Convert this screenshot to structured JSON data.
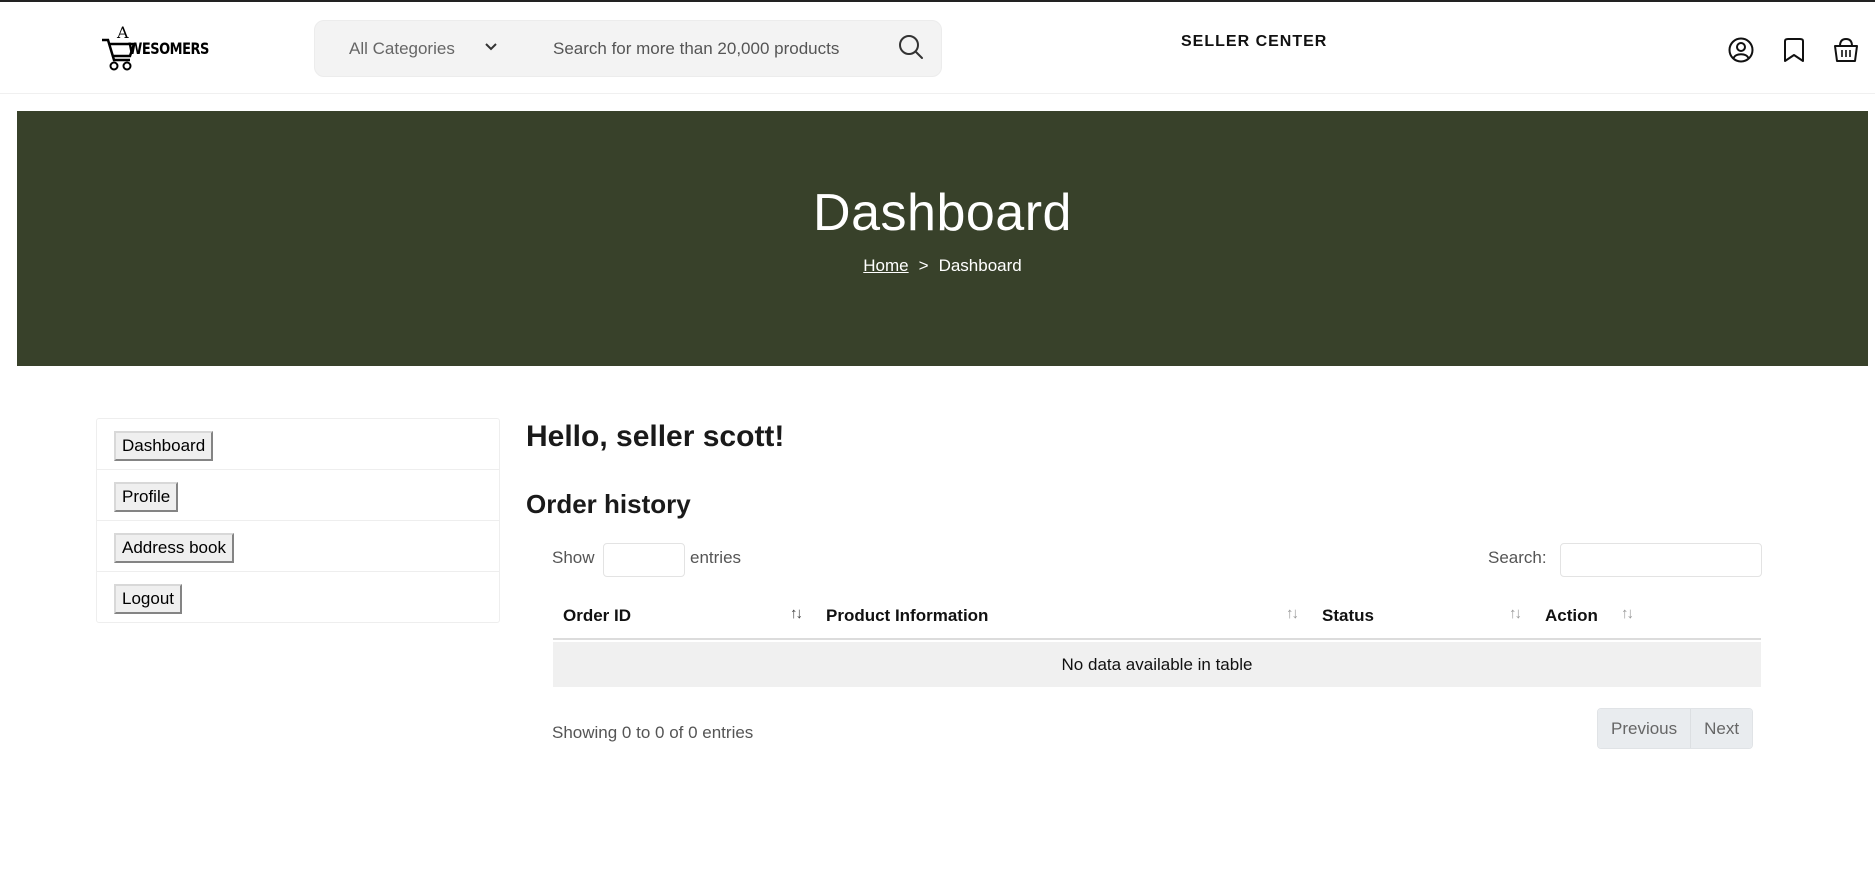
{
  "header": {
    "logo_text": "WESOMERS",
    "logo_letter": "A",
    "category_label": "All Categories",
    "search_placeholder": "Search for more than 20,000 products",
    "seller_center": "SELLER CENTER",
    "icons": [
      "user-icon",
      "bookmark-icon",
      "basket-icon"
    ]
  },
  "banner": {
    "title": "Dashboard",
    "breadcrumb": {
      "home": "Home",
      "separator": ">",
      "current": "Dashboard"
    },
    "background": "#38412a"
  },
  "sidebar": {
    "items": [
      {
        "label": "Dashboard"
      },
      {
        "label": "Profile"
      },
      {
        "label": "Address book"
      },
      {
        "label": "Logout"
      }
    ]
  },
  "main": {
    "greeting": "Hello, seller scott!",
    "section_title": "Order history",
    "table": {
      "show_label": "Show",
      "entries_label": "entries",
      "search_label": "Search:",
      "columns": [
        "Order ID",
        "Product Information",
        "Status",
        "Action"
      ],
      "empty_message": "No data available in table",
      "info": "Showing 0 to 0 of 0 entries",
      "prev_label": "Previous",
      "next_label": "Next"
    }
  }
}
